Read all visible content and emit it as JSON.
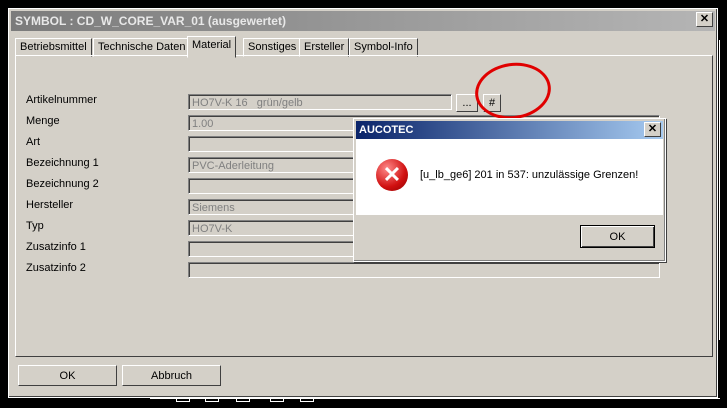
{
  "window": {
    "title": "SYMBOL : CD_W_CORE_VAR_01  (ausgewertet)",
    "close": "✕"
  },
  "tabs": [
    "Betriebsmittel",
    "Technische Daten",
    "Material",
    "Sonstiges",
    "Ersteller",
    "Symbol-Info"
  ],
  "active_tab": "Material",
  "fields": [
    {
      "label": "Artikelnummer",
      "value": "HO7V-K 16   grün/gelb"
    },
    {
      "label": "Menge",
      "value": "1.00"
    },
    {
      "label": "Art",
      "value": ""
    },
    {
      "label": "Bezeichnung 1",
      "value": "PVC-Aderleitung"
    },
    {
      "label": "Bezeichnung 2",
      "value": ""
    },
    {
      "label": "Hersteller",
      "value": "Siemens"
    },
    {
      "label": "Typ",
      "value": "HO7V-K"
    },
    {
      "label": "Zusatzinfo 1",
      "value": ""
    },
    {
      "label": "Zusatzinfo 2",
      "value": ""
    }
  ],
  "buttons": {
    "browse": "...",
    "hash": "#",
    "ok": "OK",
    "cancel": "Abbruch"
  },
  "message_box": {
    "title": "AUCOTEC",
    "close": "✕",
    "icon": "error-icon",
    "icon_glyph": "✕",
    "text": "[u_lb_ge6] 201 in 537: unzulässige Grenzen!",
    "ok": "OK"
  },
  "colors": {
    "annotation_circle": "#e00000",
    "message_title_bar": "#0a246a"
  }
}
